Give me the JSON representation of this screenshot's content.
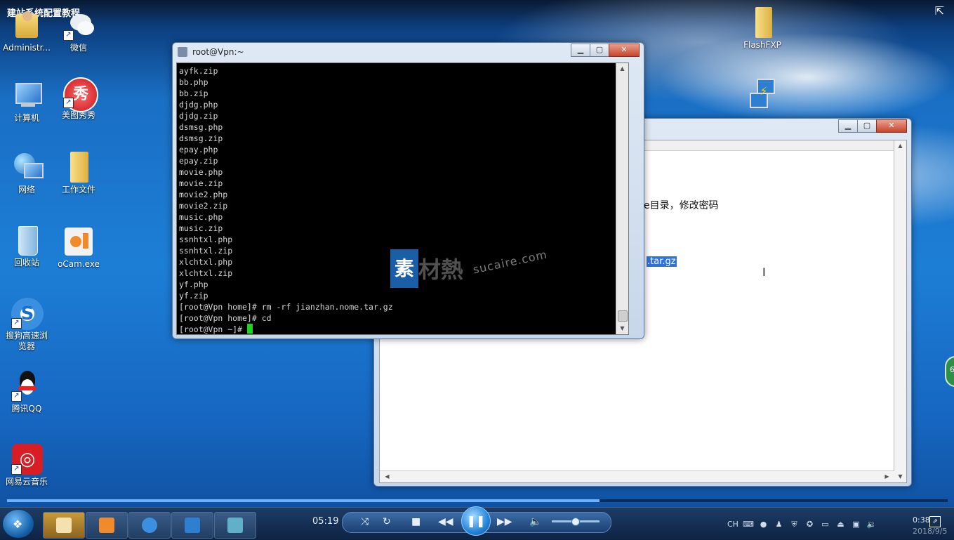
{
  "video_title": "建站系统配置教程",
  "desktop": {
    "icons": [
      {
        "label": "Administr...",
        "icon": "user-folder-icon"
      },
      {
        "label": "微信",
        "icon": "wechat-icon"
      },
      {
        "label": "计算机",
        "icon": "computer-icon"
      },
      {
        "label": "美图秀秀",
        "icon": "meitu-icon"
      },
      {
        "label": "网络",
        "icon": "network-icon"
      },
      {
        "label": "工作文件",
        "icon": "folder-icon"
      },
      {
        "label": "回收站",
        "icon": "recycle-bin-icon"
      },
      {
        "label": "oCam.exe",
        "icon": "ocam-icon"
      },
      {
        "label": "搜狗高速浏览器",
        "icon": "sogou-browser-icon"
      },
      {
        "label": "腾讯QQ",
        "icon": "qq-penguin-icon"
      },
      {
        "label": "网易云音乐",
        "icon": "netease-music-icon"
      },
      {
        "label": "FlashFXP",
        "icon": "folder-icon"
      },
      {
        "label": "",
        "icon": "putty-icon"
      }
    ]
  },
  "terminal": {
    "title": "root@Vpn:~",
    "lines": [
      "ayfk.zip",
      "bb.php",
      "bb.zip",
      "djdg.php",
      "djdg.zip",
      "dsmsg.php",
      "dsmsg.zip",
      "epay.php",
      "epay.zip",
      "movie.php",
      "movie.zip",
      "movie2.php",
      "movie2.zip",
      "music.php",
      "music.zip",
      "ssnhtxl.php",
      "ssnhtxl.zip",
      "xlchtxl.php",
      "xlchtxl.zip",
      "yf.php",
      "yf.zip",
      "[root@Vpn home]# rm -rf jianzhan.nome.tar.gz",
      "[root@Vpn home]# cd"
    ],
    "prompt": "[root@Vpn ~]# "
  },
  "editor": {
    "text_line1": "e目录，修改密码",
    "selected_text": ".tar.gz"
  },
  "watermark": {
    "box": "素",
    "text": "材熱",
    "url": "sucaire.com"
  },
  "player": {
    "time": "05:19",
    "progress": 0.63,
    "volume": 0.5,
    "clock_time": "0:38",
    "clock_date": "2018/9/5"
  },
  "side_badge": "6",
  "tray_lang": "CH"
}
